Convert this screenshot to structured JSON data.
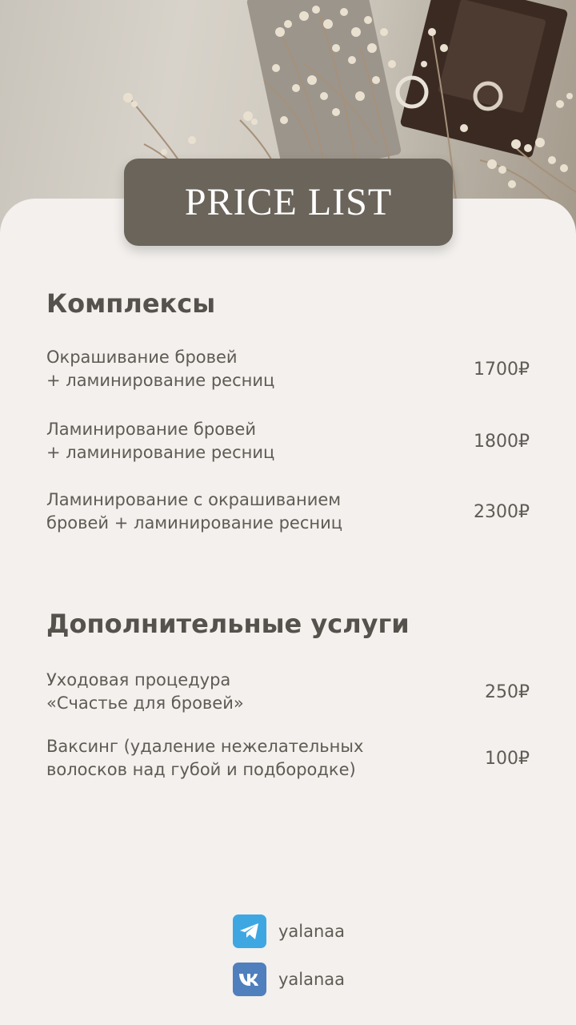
{
  "banner": {
    "title": "PRICE LIST"
  },
  "sections": [
    {
      "title": "Комплексы",
      "items": [
        {
          "name": "Окрашивание бровей\n+ ламинирование ресниц",
          "price": "1700₽"
        },
        {
          "name": "Ламинирование бровей\n+ ламинирование ресниц",
          "price": "1800₽"
        },
        {
          "name": "Ламинирование с окрашиванием\nбровей + ламинирование ресниц",
          "price": "2300₽"
        }
      ]
    },
    {
      "title": "Дополнительные услуги",
      "items": [
        {
          "name": "Уходовая процедура\n«Счастье для бровей»",
          "price": "250₽"
        },
        {
          "name": "Ваксинг (удаление нежелательных\nволосков над губой и подбородке)",
          "price": "100₽"
        }
      ]
    }
  ],
  "social": {
    "telegram": {
      "icon": "telegram-icon",
      "handle": "yalanaa",
      "color": "#3ea7e2"
    },
    "vk": {
      "icon": "vk-icon",
      "handle": "yalanaa",
      "color": "#4f7fbd"
    }
  }
}
